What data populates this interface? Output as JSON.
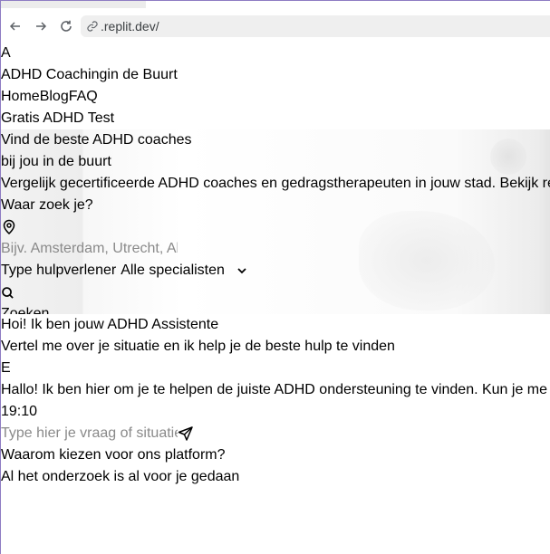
{
  "browser": {
    "url_host": ".replit.dev/"
  },
  "header": {
    "logo_letter": "A",
    "site_title": "ADHD Coachingin de Buurt",
    "nav": [
      "Home",
      "Blog",
      "FAQ"
    ],
    "cta": "Gratis ADHD Test"
  },
  "hero": {
    "title_line1": "Vind de beste ADHD coaches",
    "title_line2": "bij jou in de buurt",
    "subtitle": "Vergelijk gecertificeerde ADHD coaches en gedragstherapeuten in jouw stad. Bekijk re",
    "search_label": "Waar zoek je?",
    "location_icon": "map-pin-icon",
    "location_placeholder": "Bijv. Amsterdam, Utrecht, Almere",
    "type_label": "Type hulpverlener",
    "type_selected": "Alle specialisten",
    "search_icon": "search-icon",
    "search_button": "Zoeken"
  },
  "assistant": {
    "title": "Hoi! Ik ben jouw ADHD Assistente",
    "subtitle": "Vertel me over je situatie en ik help je de beste hulp te vinden",
    "avatar_letter": "E",
    "message": "Hallo! Ik ben hier om je te helpen de juiste ADHD ondersteuning te vinden. Kun je me",
    "time": "19:10",
    "input_placeholder": "Type hier je vraag of situatie...",
    "send_icon": "send-icon"
  },
  "why": {
    "title": "Waarom kiezen voor ons platform?",
    "subtitle": "Al het onderzoek is al voor je gedaan"
  }
}
